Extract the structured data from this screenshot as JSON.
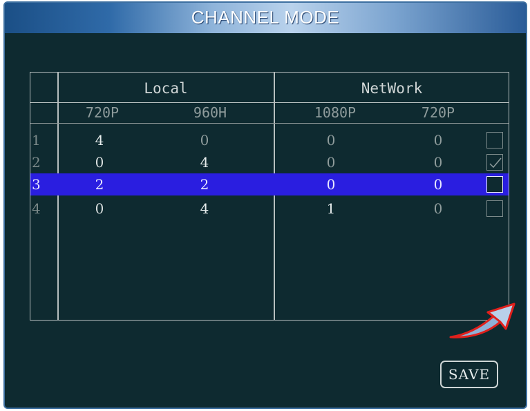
{
  "window": {
    "title": "CHANNEL MODE"
  },
  "table": {
    "groups": [
      "Local",
      "NetWork"
    ],
    "columns": [
      "720P",
      "960H",
      "1080P",
      "720P"
    ],
    "rows": [
      {
        "index": "1",
        "values": [
          "4",
          "0",
          "0",
          "0"
        ],
        "checked": false,
        "selected": false
      },
      {
        "index": "2",
        "values": [
          "0",
          "4",
          "0",
          "0"
        ],
        "checked": true,
        "selected": false
      },
      {
        "index": "3",
        "values": [
          "2",
          "2",
          "0",
          "0"
        ],
        "checked": false,
        "selected": true
      },
      {
        "index": "4",
        "values": [
          "0",
          "4",
          "1",
          "0"
        ],
        "checked": false,
        "selected": false
      }
    ]
  },
  "buttons": {
    "save_label": "SAVE"
  },
  "colors": {
    "background": "#0e2a30",
    "selection": "#2a1ee0",
    "arrow": "#e0201c"
  },
  "icons": {
    "pointer": "arrow-pointer-icon",
    "check": "checkmark-icon"
  }
}
